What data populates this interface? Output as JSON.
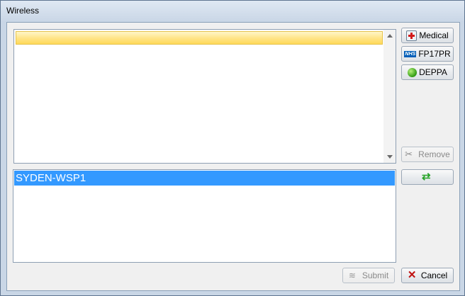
{
  "window": {
    "title": "Wireless"
  },
  "side_buttons": {
    "medical": {
      "label": "Medical",
      "icon": "medical-case-icon"
    },
    "fp17pr": {
      "label": "FP17PR",
      "icon": "nhs-logo-icon"
    },
    "deppa": {
      "label": "DEPPA",
      "icon": "green-apple-icon"
    },
    "remove": {
      "label": "Remove",
      "icon": "tools-icon",
      "disabled": true
    },
    "refresh": {
      "label": "",
      "icon": "refresh-icon"
    }
  },
  "top_list": {
    "items": [
      ""
    ]
  },
  "bottom_list": {
    "items": [
      "SYDEN-WSP1"
    ]
  },
  "footer": {
    "submit": {
      "label": "Submit",
      "icon": "wireless-icon",
      "disabled": true
    },
    "cancel": {
      "label": "Cancel",
      "icon": "close-x-icon"
    }
  }
}
